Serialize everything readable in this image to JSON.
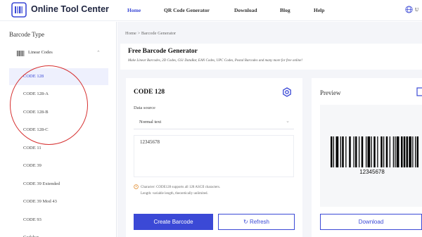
{
  "header": {
    "brand": "Online Tool Center",
    "nav": [
      "Home",
      "QR Code Generator",
      "Download",
      "Blog",
      "Help"
    ],
    "lang": "U",
    "accent": "#3b49d6"
  },
  "sidebar": {
    "title": "Barcode Type",
    "group": {
      "label": "Linear Codes",
      "icon": "barcode-icon"
    },
    "items": [
      "CODE 128",
      "CODE 128-A",
      "CODE 128-B",
      "CODE 128-C",
      "CODE 11",
      "CODE 39",
      "CODE 39 Extended",
      "CODE 39 Mod 43",
      "CODE 93",
      "Codabar"
    ],
    "selected": "CODE 128",
    "annotation_color": "#d62f2f"
  },
  "breadcrumb": {
    "home": "Home",
    "separator": ">",
    "current": "Barcode Generator"
  },
  "intro": {
    "title": "Free Barcode Generator",
    "subtitle": "Make Linear Barcodes, 2D Codes, GS1 DataBar, EAN Codes, UPC Codes, Postal Barcodes and many more for free online!"
  },
  "form": {
    "title": "CODE 128",
    "data_source_label": "Data source",
    "data_source_value": "Normal text",
    "input_value": "12345678",
    "info_line1": "Character: CODE128 supports all 128 ASCII characters.",
    "info_line2": "Length: variable length, theoretically unlimited.",
    "create_label": "Create Barcode",
    "refresh_label": "Refresh",
    "refresh_icon": "↻"
  },
  "preview": {
    "title": "Preview",
    "barcode_text": "12345678",
    "download_label": "Download"
  }
}
